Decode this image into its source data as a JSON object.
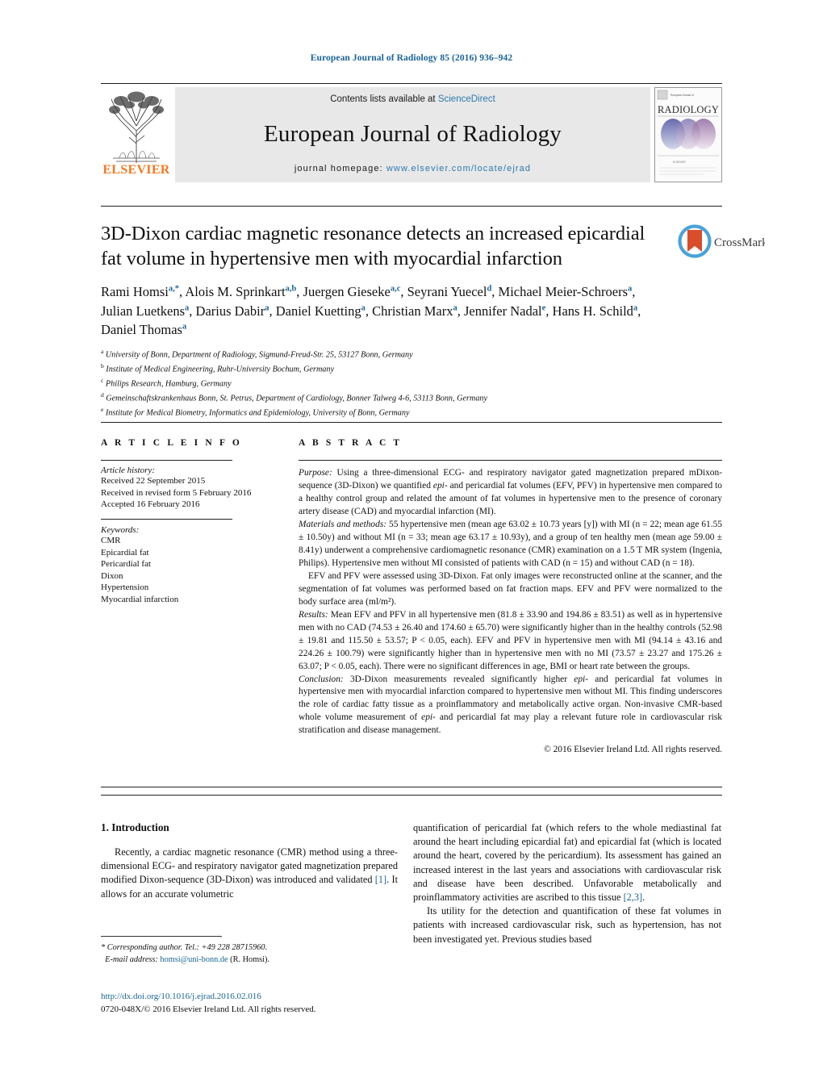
{
  "running_head": "European Journal of Radiology 85 (2016) 936–942",
  "masthead": {
    "contents_prefix": "Contents lists available at ",
    "sciencedirect": "ScienceDirect",
    "journal_title": "European Journal of Radiology",
    "homepage_prefix": "journal homepage:",
    "homepage_url": "www.elsevier.com/locate/ejrad",
    "publisher": "ELSEVIER",
    "cover_brand": "RADIOLOGY",
    "cover_top_note": "European Journal of"
  },
  "crossmark": {
    "label": "CrossMark"
  },
  "article": {
    "title": "3D-Dixon cardiac magnetic resonance detects an increased epicardial fat volume in hypertensive men with myocardial infarction",
    "authors_html": "Rami Homsi<sup>a,<span class=\"star\">*</span></sup>, Alois M. Sprinkart<sup>a,b</sup>, Juergen Gieseke<sup>a,c</sup>, Seyrani Yuecel<sup>d</sup>, Michael Meier-Schroers<sup>a</sup>, Julian Luetkens<sup>a</sup>, Darius Dabir<sup>a</sup>, Daniel Kuetting<sup>a</sup>, Christian Marx<sup>a</sup>, Jennifer Nadal<sup>e</sup>, Hans H. Schild<sup>a</sup>, Daniel Thomas<sup>a</sup>",
    "affiliations": [
      {
        "marker": "a",
        "text": "University of Bonn, Department of Radiology, Sigmund-Freud-Str. 25, 53127 Bonn, Germany"
      },
      {
        "marker": "b",
        "text": "Institute of Medical Engineering, Ruhr-University Bochum, Germany"
      },
      {
        "marker": "c",
        "text": "Philips Research, Hamburg, Germany"
      },
      {
        "marker": "d",
        "text": "Gemeinschaftskrankenhaus Bonn, St. Petrus, Department of Cardiology, Bonner Talweg 4-6, 53113 Bonn, Germany"
      },
      {
        "marker": "e",
        "text": "Institute for Medical Biometry, Informatics and Epidemiology, University of Bonn, Germany"
      }
    ]
  },
  "section_heads": {
    "article_info": "A R T I C L E    I N F O",
    "abstract": "A B S T R A C T"
  },
  "article_info": {
    "history_title": "Article history:",
    "history": [
      "Received 22 September 2015",
      "Received in revised form 5 February 2016",
      "Accepted 16 February 2016"
    ],
    "keywords_title": "Keywords:",
    "keywords": [
      "CMR",
      "Epicardial fat",
      "Pericardial fat",
      "Dixon",
      "Hypertension",
      "Myocardial infarction"
    ]
  },
  "abstract": {
    "purpose_label": "Purpose:",
    "purpose_text": " Using a three-dimensional ECG- and respiratory navigator gated magnetization prepared mDixon-sequence (3D-Dixon) we quantified epi- and pericardial fat volumes (EFV, PFV) in hypertensive men compared to a healthy control group and related the amount of fat volumes in hypertensive men to the presence of coronary artery disease (CAD) and myocardial infarction (MI).",
    "methods_label": "Materials and methods:",
    "methods_text": " 55 hypertensive men (mean age 63.02 ± 10.73 years [y]) with MI (n = 22; mean age 61.55 ± 10.50y) and without MI (n = 33; mean age 63.17 ± 10.93y), and a group of ten healthy men (mean age 59.00 ± 8.41y) underwent a comprehensive cardiomagnetic resonance (CMR) examination on a 1.5 T MR system (Ingenia, Philips). Hypertensive men without MI consisted of patients with CAD (n = 15) and without CAD (n = 18).",
    "methods_text2": "EFV and PFV were assessed using 3D-Dixon. Fat only images were reconstructed online at the scanner, and the segmentation of fat volumes was performed based on fat fraction maps. EFV and PFV were normalized to the body surface area (ml/m²).",
    "results_label": "Results:",
    "results_text": " Mean EFV and PFV in all hypertensive men (81.8 ± 33.90 and 194.86 ± 83.51) as well as in hypertensive men with no CAD (74.53 ± 26.40 and 174.60 ± 65.70) were significantly higher than in the healthy controls (52.98 ± 19.81 and 115.50 ± 53.57; P < 0.05, each). EFV and PFV in hypertensive men with MI (94.14 ± 43.16 and 224.26 ± 100.79) were significantly higher than in hypertensive men with no MI (73.57 ± 23.27 and 175.26 ± 63.07; P < 0.05, each). There were no significant differences in age, BMI or heart rate between the groups.",
    "conclusion_label": "Conclusion:",
    "conclusion_text": " 3D-Dixon measurements revealed significantly higher epi- and pericardial fat volumes in hypertensive men with myocardial infarction compared to hypertensive men without MI. This finding underscores the role of cardiac fatty tissue as a proinflammatory and metabolically active organ. Non-invasive CMR-based whole volume measurement of epi- and pericardial fat may play a relevant future role in cardiovascular risk stratification and disease management.",
    "copyright": "© 2016 Elsevier Ireland Ltd. All rights reserved."
  },
  "body": {
    "intro_heading": "1. Introduction",
    "intro_p1_pre": "Recently, a cardiac magnetic resonance (CMR) method using a three-dimensional ECG- and respiratory navigator gated magnetization prepared modified Dixon-sequence (3D-Dixon) was introduced and validated ",
    "intro_p1_ref": "[1]",
    "intro_p1_post": ". It allows for an accurate volumetric",
    "right_p1_pre": "quantification of pericardial fat (which refers to the whole mediastinal fat around the heart including epicardial fat) and epicardial fat (which is located around the heart, covered by the pericardium). Its assessment has gained an increased interest in the last years and associations with cardiovascular risk and disease have been described. Unfavorable metabolically and proinflammatory activities are ascribed to this tissue ",
    "right_p1_ref": "[2,3]",
    "right_p1_post": ".",
    "right_p2": "Its utility for the detection and quantification of these fat volumes in patients with increased cardiovascular risk, such as hypertension, has not been investigated yet. Previous studies based"
  },
  "footnote": {
    "star": "*",
    "corresponding_label": "Corresponding author. Tel.: +49 228 28715960.",
    "email_label": "E-mail address:",
    "email": "homsi@uni-bonn.de",
    "email_suffix": "(R. Homsi)."
  },
  "doi": {
    "url": "http://dx.doi.org/10.1016/j.ejrad.2016.02.016",
    "issn_line": "0720-048X/© 2016 Elsevier Ireland Ltd. All rights reserved."
  },
  "colors": {
    "link": "#1a6496",
    "elsevier_orange": "#F47920",
    "masthead_bg": "#e8e8e8",
    "sciencedirect": "#2a7ab0"
  }
}
